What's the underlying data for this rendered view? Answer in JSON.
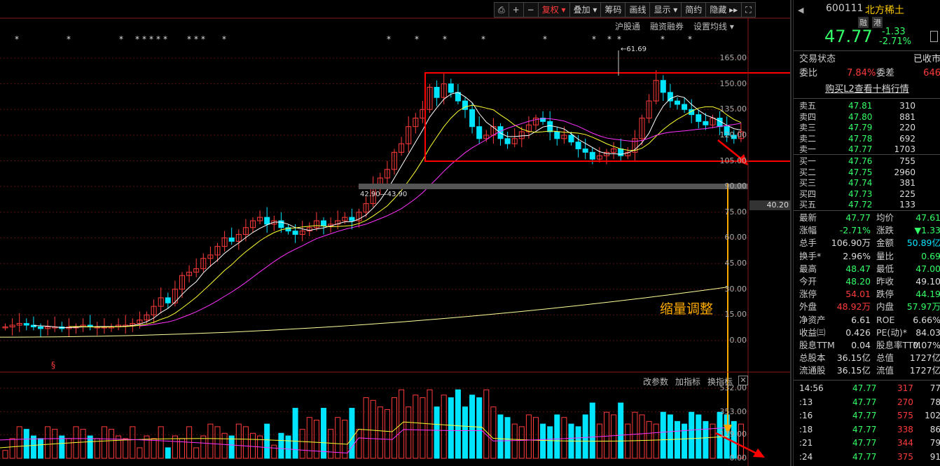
{
  "toolbar": {
    "items": [
      "⎙",
      "+",
      "−",
      "复权 ▾",
      "叠加 ▾",
      "筹码",
      "画线",
      "显示 ▾",
      "简约",
      "隐藏 ▸▸",
      "⛶"
    ]
  },
  "subbar": [
    "沪股通",
    "融资融券",
    "设置均线 ▾"
  ],
  "ind_bar": [
    "改参数",
    "加指标",
    "换指标"
  ],
  "price_axis": [
    "165.00",
    "150.00",
    "135.00",
    "120.00",
    "105.00",
    "90.00",
    "75.00",
    "60.00",
    "45.00",
    "30.00",
    "15.00",
    "0.00"
  ],
  "price_tag": "40.20",
  "vol_axis": [
    "532.00",
    "353.00",
    "179.00",
    "0.00"
  ],
  "annotations": {
    "high_label": "←61.69",
    "range_label": "42.90—43.90",
    "note": "缩量调整",
    "dollar": "§"
  },
  "quote": {
    "code": "600111",
    "name": "北方稀土",
    "tags": [
      "融",
      "港"
    ],
    "price": "47.77",
    "change": "-1.33",
    "pct": "-2.71%",
    "status_label": "交易状态",
    "status_value": "已收市",
    "wb_label": "委比",
    "wb_value": "7.84%",
    "wc_label": "委差",
    "wc_value": "646",
    "l2": "购买L2查看十档行情"
  },
  "sells": [
    {
      "label": "卖五",
      "price": "47.81",
      "vol": "310"
    },
    {
      "label": "卖四",
      "price": "47.80",
      "vol": "881"
    },
    {
      "label": "卖三",
      "price": "47.79",
      "vol": "220"
    },
    {
      "label": "卖二",
      "price": "47.78",
      "vol": "692"
    },
    {
      "label": "卖一",
      "price": "47.77",
      "vol": "1703"
    }
  ],
  "buys": [
    {
      "label": "买一",
      "price": "47.76",
      "vol": "755"
    },
    {
      "label": "买二",
      "price": "47.75",
      "vol": "2960"
    },
    {
      "label": "买三",
      "price": "47.74",
      "vol": "381"
    },
    {
      "label": "买四",
      "price": "47.73",
      "vol": "225"
    },
    {
      "label": "买五",
      "price": "47.72",
      "vol": "133"
    }
  ],
  "stats": [
    {
      "l1": "最新",
      "v1": "47.77",
      "c1": "g",
      "l2": "均价",
      "v2": "47.61",
      "c2": "g"
    },
    {
      "l1": "涨幅",
      "v1": "-2.71%",
      "c1": "g",
      "l2": "涨跌",
      "v2": "▼1.33",
      "c2": "g"
    },
    {
      "l1": "总手",
      "v1": "106.90万",
      "c1": "w",
      "l2": "金额",
      "v2": "50.89亿",
      "c2": "c"
    },
    {
      "l1": "换手*",
      "v1": "2.96%",
      "c1": "w",
      "l2": "量比",
      "v2": "0.69",
      "c2": "g"
    },
    {
      "l1": "最高",
      "v1": "48.47",
      "c1": "g",
      "l2": "最低",
      "v2": "47.00",
      "c2": "g"
    },
    {
      "l1": "今开",
      "v1": "48.20",
      "c1": "g",
      "l2": "昨收",
      "v2": "49.10",
      "c2": "w"
    },
    {
      "l1": "涨停",
      "v1": "54.01",
      "c1": "r",
      "l2": "跌停",
      "v2": "44.19",
      "c2": "g"
    },
    {
      "l1": "外盘",
      "v1": "48.92万",
      "c1": "r",
      "l2": "内盘",
      "v2": "57.97万",
      "c2": "g"
    },
    {
      "l1": "净资产",
      "v1": "6.61",
      "c1": "w",
      "l2": "ROE",
      "v2": "6.66%",
      "c2": "w"
    },
    {
      "l1": "收益㈢",
      "v1": "0.426",
      "c1": "w",
      "l2": "PE(动)*",
      "v2": "84.03",
      "c2": "w"
    },
    {
      "l1": "股息TTM",
      "v1": "0.04",
      "c1": "w",
      "l2": "股息率TTM",
      "v2": "0.07%",
      "c2": "w"
    },
    {
      "l1": "总股本",
      "v1": "36.15亿",
      "c1": "w",
      "l2": "总值",
      "v2": "1727亿",
      "c2": "w"
    },
    {
      "l1": "流通股",
      "v1": "36.15亿",
      "c1": "w",
      "l2": "流值",
      "v2": "1727亿",
      "c2": "w"
    }
  ],
  "ticks": [
    {
      "t": "14:56",
      "p": "47.77",
      "v": "317",
      "n": "77"
    },
    {
      "t": ":13",
      "p": "47.77",
      "v": "270",
      "n": "78"
    },
    {
      "t": ":16",
      "p": "47.77",
      "v": "575",
      "n": "102"
    },
    {
      "t": ":18",
      "p": "47.77",
      "v": "338",
      "n": "86"
    },
    {
      "t": ":21",
      "p": "47.77",
      "v": "344",
      "n": "79"
    },
    {
      "t": ":24",
      "p": "47.77",
      "v": "375",
      "n": "91"
    }
  ],
  "colors": {
    "up": "#ff3b3b",
    "down": "#00e5ff",
    "ma5": "#ffffff",
    "ma10": "#ffff33",
    "ma20": "#ff33ff",
    "ma250": "#ffff99",
    "box": "#ff0000",
    "arrow": "#ffaa00"
  }
}
